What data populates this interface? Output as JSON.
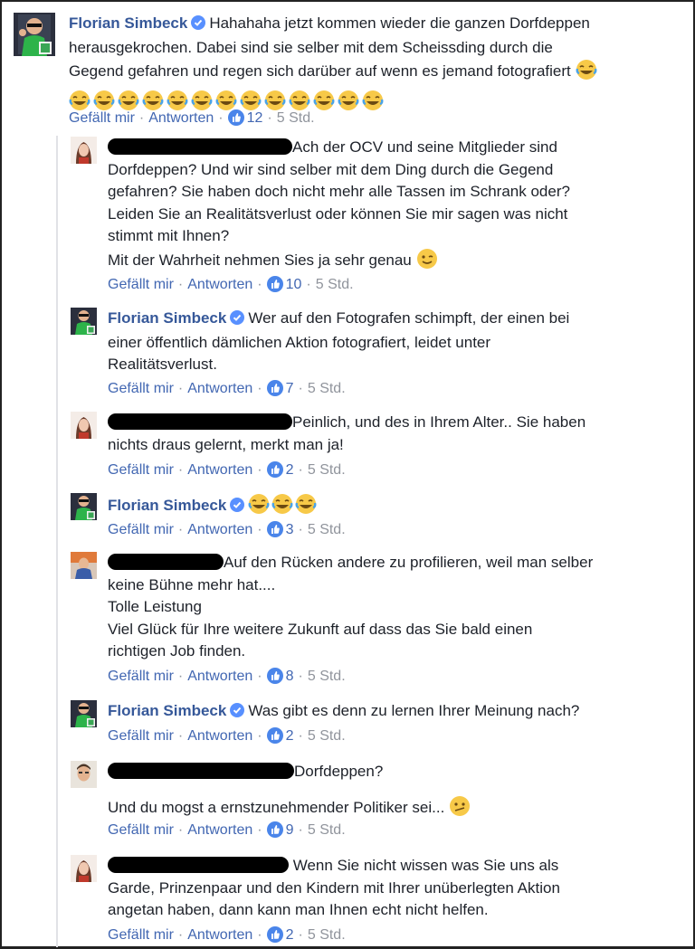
{
  "comments": [
    {
      "author": "Florian Simbeck",
      "text": "Hahahaha jetzt kommen wieder die ganzen Dorfdeppen herausgekrochen. Dabei sind sie selber mit dem Scheissding durch die Gegend gefahren und regen sich darüber auf wenn es jemand fotografiert",
      "line1": "Hahahaha jetzt kommen wieder die ganzen Dorfdeppen",
      "line2": "herausgekrochen. Dabei sind sie selber mit dem Scheissding durch die",
      "line3": "Gegend gefahren und regen sich darüber auf wenn es jemand fotografiert",
      "emoji": "😂",
      "emoji_row_count": 13,
      "like_label": "Gefällt mir",
      "reply_label": "Antworten",
      "likes": "12",
      "time": "5 Std."
    },
    {
      "author_redacted": true,
      "line1": "Ach der OCV und seine Mitglieder sind",
      "line2": "Dorfdeppen? Und wir sind selber mit dem Ding durch die Gegend",
      "line3": "gefahren? Sie haben doch nicht mehr alle Tassen im Schrank oder?",
      "line4": "Leiden Sie an Realitätsverlust oder können Sie mir sagen was nicht",
      "line5": "stimmt mit Ihnen?",
      "line6": "Mit der Wahrheit nehmen Sies ja sehr genau",
      "emoji": "😉",
      "like_label": "Gefällt mir",
      "reply_label": "Antworten",
      "likes": "10",
      "time": "5 Std."
    },
    {
      "author": "Florian Simbeck",
      "line1": "Wer auf den Fotografen schimpft, der einen bei",
      "line2": "einer öffentlich dämlichen Aktion fotografiert, leidet unter",
      "line3": "Realitätsverlust.",
      "like_label": "Gefällt mir",
      "reply_label": "Antworten",
      "likes": "7",
      "time": "5 Std."
    },
    {
      "author_redacted": true,
      "line1": "Peinlich, und des in Ihrem Alter.. Sie haben",
      "line2": "nichts draus gelernt, merkt man ja!",
      "like_label": "Gefällt mir",
      "reply_label": "Antworten",
      "likes": "2",
      "time": "5 Std."
    },
    {
      "author": "Florian Simbeck",
      "emoji": "😂",
      "like_label": "Gefällt mir",
      "reply_label": "Antworten",
      "likes": "3",
      "time": "5 Std."
    },
    {
      "author_redacted": true,
      "line1": "Auf den Rücken andere zu profilieren, weil man selber",
      "line2": "keine Bühne mehr hat....",
      "line3": "Tolle Leistung",
      "line4": "Viel Glück für Ihre weitere Zukunft auf dass das Sie bald einen",
      "line5": "richtigen Job finden.",
      "like_label": "Gefällt mir",
      "reply_label": "Antworten",
      "likes": "8",
      "time": "5 Std."
    },
    {
      "author": "Florian Simbeck",
      "line1": "Was gibt es denn zu lernen Ihrer Meinung nach?",
      "like_label": "Gefällt mir",
      "reply_label": "Antworten",
      "likes": "2",
      "time": "5 Std."
    },
    {
      "author_redacted": true,
      "line1": "Dorfdeppen?",
      "line2": "Und du mogst a ernstzunehmender Politiker sei...",
      "emoji": "😕",
      "like_label": "Gefällt mir",
      "reply_label": "Antworten",
      "likes": "9",
      "time": "5 Std."
    },
    {
      "author_redacted": true,
      "line1": "Wenn Sie nicht wissen was Sie uns als",
      "line2": "Garde, Prinzenpaar und den Kindern mit Ihrer unüberlegten Aktion",
      "line3": "angetan haben, dann kann man Ihnen echt nicht helfen.",
      "like_label": "Gefällt mir",
      "reply_label": "Antworten",
      "likes": "2",
      "time": "5 Std."
    }
  ],
  "colors": {
    "author": "#365899",
    "link": "#4267b2",
    "meta": "#90949c",
    "text": "#1d2129",
    "verified": "#5890ff"
  },
  "icons": {
    "verified": "verified-badge-icon",
    "like": "thumbs-up-icon"
  }
}
